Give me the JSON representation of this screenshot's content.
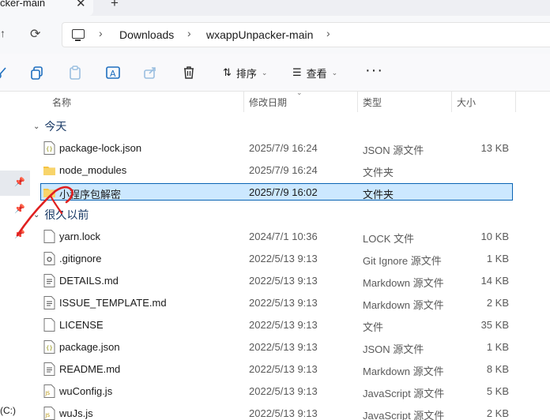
{
  "tab": {
    "title": "cker-main",
    "close_glyph": "✕",
    "new_glyph": "+"
  },
  "address": {
    "breadcrumb_sep": "›",
    "crumbs": [
      "Downloads",
      "wxappUnpacker-main"
    ]
  },
  "toolbar": {
    "sort_label": "排序",
    "view_label": "查看",
    "more_label": "···"
  },
  "nav": {
    "drive_label": "(C:)"
  },
  "columns": {
    "name": "名称",
    "date": "修改日期",
    "type": "类型",
    "size": "大小"
  },
  "groups": {
    "today": {
      "label": "今天"
    },
    "earlier": {
      "label": "很久以前"
    }
  },
  "today_files": [
    {
      "name": "package-lock.json",
      "date": "2025/7/9 16:24",
      "type": "JSON 源文件",
      "size": "13 KB",
      "icon": "json-file-icon"
    },
    {
      "name": "node_modules",
      "date": "2025/7/9 16:24",
      "type": "文件夹",
      "size": "",
      "icon": "folder-icon"
    },
    {
      "name": "小程序包解密",
      "date": "2025/7/9 16:02",
      "type": "文件夹",
      "size": "",
      "icon": "folder-icon",
      "selected": true
    }
  ],
  "earlier_files": [
    {
      "name": "yarn.lock",
      "date": "2024/7/1 10:36",
      "type": "LOCK 文件",
      "size": "10 KB",
      "icon": "file-icon"
    },
    {
      "name": ".gitignore",
      "date": "2022/5/13 9:13",
      "type": "Git Ignore 源文件",
      "size": "1 KB",
      "icon": "gear-file-icon"
    },
    {
      "name": "DETAILS.md",
      "date": "2022/5/13 9:13",
      "type": "Markdown 源文件",
      "size": "14 KB",
      "icon": "markdown-file-icon"
    },
    {
      "name": "ISSUE_TEMPLATE.md",
      "date": "2022/5/13 9:13",
      "type": "Markdown 源文件",
      "size": "2 KB",
      "icon": "markdown-file-icon"
    },
    {
      "name": "LICENSE",
      "date": "2022/5/13 9:13",
      "type": "文件",
      "size": "35 KB",
      "icon": "file-icon"
    },
    {
      "name": "package.json",
      "date": "2022/5/13 9:13",
      "type": "JSON 源文件",
      "size": "1 KB",
      "icon": "json-file-icon"
    },
    {
      "name": "README.md",
      "date": "2022/5/13 9:13",
      "type": "Markdown 源文件",
      "size": "8 KB",
      "icon": "markdown-file-icon"
    },
    {
      "name": "wuConfig.js",
      "date": "2022/5/13 9:13",
      "type": "JavaScript 源文件",
      "size": "5 KB",
      "icon": "js-file-icon"
    },
    {
      "name": "wuJs.js",
      "date": "2022/5/13 9:13",
      "type": "JavaScript 源文件",
      "size": "2 KB",
      "icon": "js-file-icon"
    }
  ],
  "colors": {
    "selection_bg": "#cce8ff",
    "selection_border": "#0a64b4",
    "folder": "#f5c342",
    "annotation": "#e02020",
    "group_header": "#1a3a66"
  }
}
